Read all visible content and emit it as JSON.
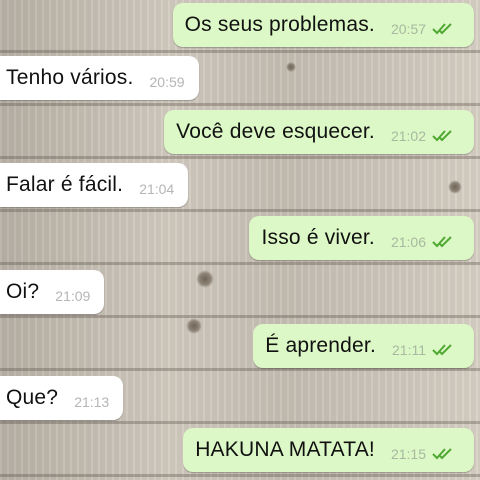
{
  "conversation": {
    "messages": [
      {
        "direction": "outgoing",
        "text": "Os seus problemas.",
        "time": "20:57",
        "status_icon": "double-check-icon"
      },
      {
        "direction": "incoming",
        "text": "Tenho vários.",
        "time": "20:59"
      },
      {
        "direction": "outgoing",
        "text": "Você deve esquecer.",
        "time": "21:02",
        "status_icon": "double-check-icon"
      },
      {
        "direction": "incoming",
        "text": "Falar é fácil.",
        "time": "21:04"
      },
      {
        "direction": "outgoing",
        "text": "Isso é viver.",
        "time": "21:06",
        "status_icon": "double-check-icon"
      },
      {
        "direction": "incoming",
        "text": "Oi?",
        "time": "21:09"
      },
      {
        "direction": "outgoing",
        "text": "É aprender.",
        "time": "21:11",
        "status_icon": "double-check-icon"
      },
      {
        "direction": "incoming",
        "text": "Que?",
        "time": "21:13"
      },
      {
        "direction": "outgoing",
        "text": "HAKUNA MATATA!",
        "time": "21:15",
        "status_icon": "double-check-icon"
      }
    ]
  },
  "colors": {
    "outgoing_bubble": "#dcf8c6",
    "incoming_bubble": "#ffffff",
    "read_tick": "#4fa832",
    "wallpaper": "#c7bfb3"
  }
}
